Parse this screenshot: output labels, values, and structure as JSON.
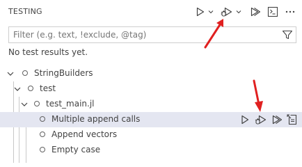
{
  "header": {
    "title": "TESTING"
  },
  "toolbar": {
    "icons": [
      "run-tests-icon",
      "chevron-down-icon",
      "debug-tests-icon",
      "chevron-down-icon",
      "run-with-coverage-icon",
      "show-output-icon",
      "more-actions-icon"
    ]
  },
  "filter": {
    "value": "",
    "placeholder": "Filter (e.g. text, !exclude, @tag)"
  },
  "status": {
    "message": "No test results yet."
  },
  "tree": {
    "items": [
      {
        "label": "StringBuilders",
        "expanded": true
      },
      {
        "label": "test",
        "expanded": true
      },
      {
        "label": "test_main.jl",
        "expanded": true
      },
      {
        "label": "Multiple append calls",
        "selected": true
      },
      {
        "label": "Append vectors"
      },
      {
        "label": "Empty case"
      }
    ]
  },
  "row_actions": {
    "icons": [
      "run-test-icon",
      "debug-test-icon",
      "run-coverage-icon",
      "go-to-test-icon"
    ]
  },
  "colors": {
    "accent_annotation": "#e02020",
    "selection_background": "#e4e6f1",
    "icon": "#424242"
  }
}
